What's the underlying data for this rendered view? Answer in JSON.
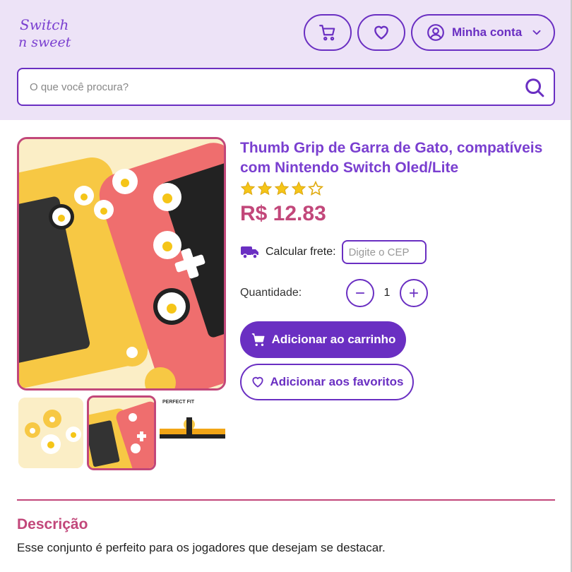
{
  "brand": {
    "logo_alt": "Switch n Sweet",
    "logo_line1": "Switch",
    "logo_line2": "n sweet"
  },
  "header": {
    "cart_icon": "cart-icon",
    "favorites_icon": "heart-icon",
    "account_label": "Minha conta",
    "search_placeholder": "O que você procura?"
  },
  "product": {
    "title": "Thumb Grip de Garra de Gato, compatíveis com Nintendo Switch Oled/Lite",
    "rating": 4,
    "rating_max": 5,
    "price": "R$ 12.83",
    "shipping_label": "Calcular frete:",
    "cep_placeholder": "Digite o CEP",
    "quantity_label": "Quantidade:",
    "quantity": "1",
    "add_to_cart": "Adicionar ao carrinho",
    "add_to_favorites": "Adicionar aos favoritos",
    "thumb_text": "PERFECT FIT"
  },
  "description": {
    "title": "Descrição",
    "text": "Esse conjunto é perfeito para os jogadores que desejam se destacar."
  },
  "colors": {
    "primary": "#6a2fc2",
    "accent": "#c2477a",
    "header_bg": "#ede3f7",
    "star": "#f5c518"
  }
}
